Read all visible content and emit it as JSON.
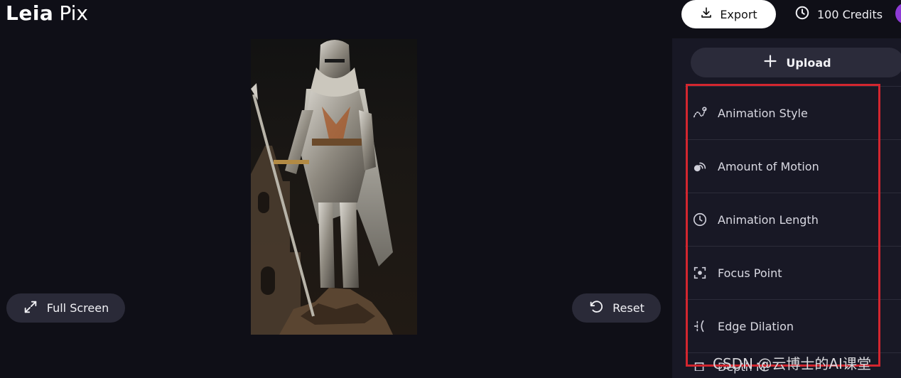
{
  "header": {
    "logo_leia": "Leia",
    "logo_pix": "Pix",
    "export_label": "Export",
    "credits_label": "100 Credits"
  },
  "canvas": {
    "fullscreen_label": "Full Screen",
    "reset_label": "Reset"
  },
  "panel": {
    "upload_label": "Upload",
    "items": [
      {
        "label": "Animation Style",
        "icon": "animation-style-icon"
      },
      {
        "label": "Amount of Motion",
        "icon": "motion-icon"
      },
      {
        "label": "Animation Length",
        "icon": "clock-icon"
      },
      {
        "label": "Focus Point",
        "icon": "focus-point-icon"
      },
      {
        "label": "Edge Dilation",
        "icon": "edge-dilation-icon"
      }
    ],
    "partial_item_label": "Depth M"
  },
  "watermark": "CSDN @云博士的AI课堂",
  "colors": {
    "background": "#0f0f17",
    "panel": "#181825",
    "button": "#2a2a38",
    "highlight": "#d3262f",
    "avatar": "#8e3bd6"
  }
}
